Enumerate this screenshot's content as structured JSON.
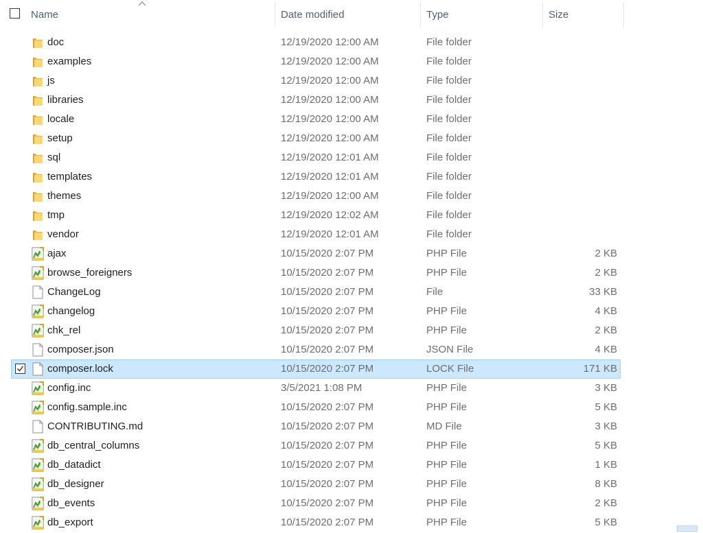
{
  "columns": {
    "name": "Name",
    "date_modified": "Date modified",
    "type": "Type",
    "size": "Size"
  },
  "selected_index": 17,
  "files": [
    {
      "name": "doc",
      "date": "12/19/2020 12:00 AM",
      "type": "File folder",
      "size": "",
      "icon": "folder-icon"
    },
    {
      "name": "examples",
      "date": "12/19/2020 12:00 AM",
      "type": "File folder",
      "size": "",
      "icon": "folder-icon"
    },
    {
      "name": "js",
      "date": "12/19/2020 12:00 AM",
      "type": "File folder",
      "size": "",
      "icon": "folder-icon"
    },
    {
      "name": "libraries",
      "date": "12/19/2020 12:00 AM",
      "type": "File folder",
      "size": "",
      "icon": "folder-icon"
    },
    {
      "name": "locale",
      "date": "12/19/2020 12:00 AM",
      "type": "File folder",
      "size": "",
      "icon": "folder-icon"
    },
    {
      "name": "setup",
      "date": "12/19/2020 12:00 AM",
      "type": "File folder",
      "size": "",
      "icon": "folder-icon"
    },
    {
      "name": "sql",
      "date": "12/19/2020 12:01 AM",
      "type": "File folder",
      "size": "",
      "icon": "folder-icon"
    },
    {
      "name": "templates",
      "date": "12/19/2020 12:01 AM",
      "type": "File folder",
      "size": "",
      "icon": "folder-icon"
    },
    {
      "name": "themes",
      "date": "12/19/2020 12:00 AM",
      "type": "File folder",
      "size": "",
      "icon": "folder-icon"
    },
    {
      "name": "tmp",
      "date": "12/19/2020 12:02 AM",
      "type": "File folder",
      "size": "",
      "icon": "folder-icon"
    },
    {
      "name": "vendor",
      "date": "12/19/2020 12:01 AM",
      "type": "File folder",
      "size": "",
      "icon": "folder-icon"
    },
    {
      "name": "ajax",
      "date": "10/15/2020 2:07 PM",
      "type": "PHP File",
      "size": "2 KB",
      "icon": "php-file-icon"
    },
    {
      "name": "browse_foreigners",
      "date": "10/15/2020 2:07 PM",
      "type": "PHP File",
      "size": "2 KB",
      "icon": "php-file-icon"
    },
    {
      "name": "ChangeLog",
      "date": "10/15/2020 2:07 PM",
      "type": "File",
      "size": "33 KB",
      "icon": "blank-file-icon"
    },
    {
      "name": "changelog",
      "date": "10/15/2020 2:07 PM",
      "type": "PHP File",
      "size": "4 KB",
      "icon": "php-file-icon"
    },
    {
      "name": "chk_rel",
      "date": "10/15/2020 2:07 PM",
      "type": "PHP File",
      "size": "2 KB",
      "icon": "php-file-icon"
    },
    {
      "name": "composer.json",
      "date": "10/15/2020 2:07 PM",
      "type": "JSON File",
      "size": "4 KB",
      "icon": "blank-file-icon"
    },
    {
      "name": "composer.lock",
      "date": "10/15/2020 2:07 PM",
      "type": "LOCK File",
      "size": "171 KB",
      "icon": "blank-file-icon"
    },
    {
      "name": "config.inc",
      "date": "3/5/2021 1:08 PM",
      "type": "PHP File",
      "size": "3 KB",
      "icon": "php-file-icon"
    },
    {
      "name": "config.sample.inc",
      "date": "10/15/2020 2:07 PM",
      "type": "PHP File",
      "size": "5 KB",
      "icon": "php-file-icon"
    },
    {
      "name": "CONTRIBUTING.md",
      "date": "10/15/2020 2:07 PM",
      "type": "MD File",
      "size": "3 KB",
      "icon": "blank-file-icon"
    },
    {
      "name": "db_central_columns",
      "date": "10/15/2020 2:07 PM",
      "type": "PHP File",
      "size": "5 KB",
      "icon": "php-file-icon"
    },
    {
      "name": "db_datadict",
      "date": "10/15/2020 2:07 PM",
      "type": "PHP File",
      "size": "1 KB",
      "icon": "php-file-icon"
    },
    {
      "name": "db_designer",
      "date": "10/15/2020 2:07 PM",
      "type": "PHP File",
      "size": "8 KB",
      "icon": "php-file-icon"
    },
    {
      "name": "db_events",
      "date": "10/15/2020 2:07 PM",
      "type": "PHP File",
      "size": "2 KB",
      "icon": "php-file-icon"
    },
    {
      "name": "db_export",
      "date": "10/15/2020 2:07 PM",
      "type": "PHP File",
      "size": "5 KB",
      "icon": "php-file-icon"
    }
  ]
}
